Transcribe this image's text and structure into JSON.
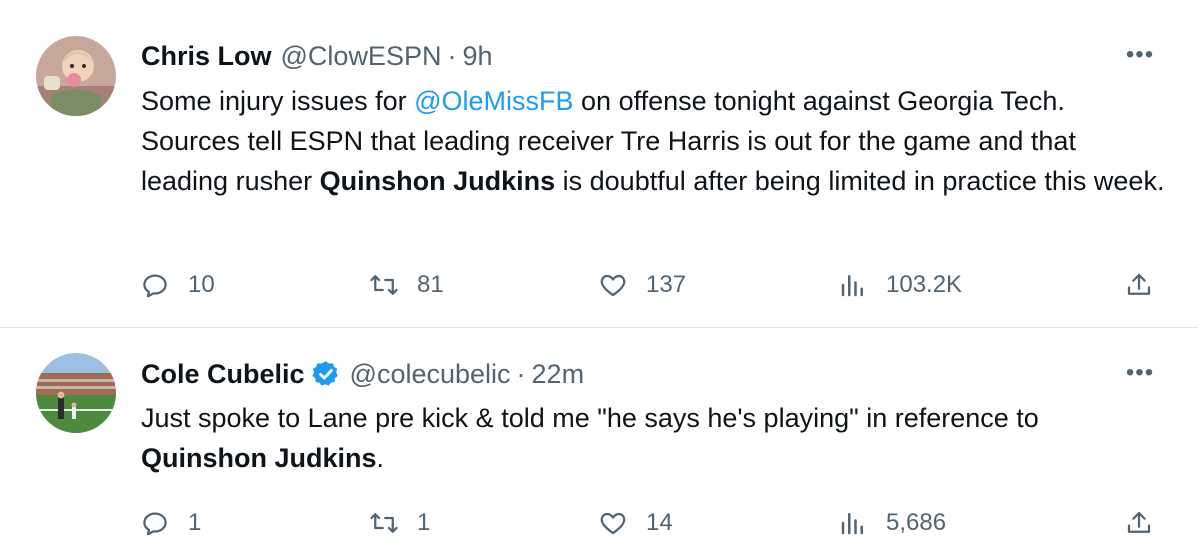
{
  "tweets": [
    {
      "author": {
        "name": "Chris Low",
        "handle": "@ClowESPN",
        "verified": false
      },
      "separator": "·",
      "time": "9h",
      "more_label": "•••",
      "text": {
        "p1": "Some injury issues for ",
        "mention": "@OleMissFB",
        "p2": " on offense tonight against Georgia Tech. Sources tell ESPN that leading receiver Tre Harris is out for the game and that leading rusher ",
        "bold": "Quinshon Judkins",
        "p3": " is doubtful after being limited in practice this week."
      },
      "stats": {
        "replies": "10",
        "retweets": "81",
        "likes": "137",
        "views": "103.2K"
      }
    },
    {
      "author": {
        "name": "Cole Cubelic",
        "handle": "@colecubelic",
        "verified": true
      },
      "separator": "·",
      "time": "22m",
      "more_label": "•••",
      "text": {
        "p1": "Just spoke to Lane pre kick & told me \"he says he's playing\" in reference to ",
        "bold": "Quinshon Judkins",
        "p2": "."
      },
      "stats": {
        "replies": "1",
        "retweets": "1",
        "likes": "14",
        "views": "5,686"
      }
    }
  ],
  "icons": {
    "reply": "reply-icon",
    "retweet": "retweet-icon",
    "like": "heart-icon",
    "views": "views-icon",
    "share": "share-icon",
    "verified": "verified-badge-icon",
    "more": "more-icon"
  },
  "colors": {
    "text": "#0f1419",
    "muted": "#536471",
    "accent": "#1d9bf0",
    "divider": "#e6e9ec"
  }
}
